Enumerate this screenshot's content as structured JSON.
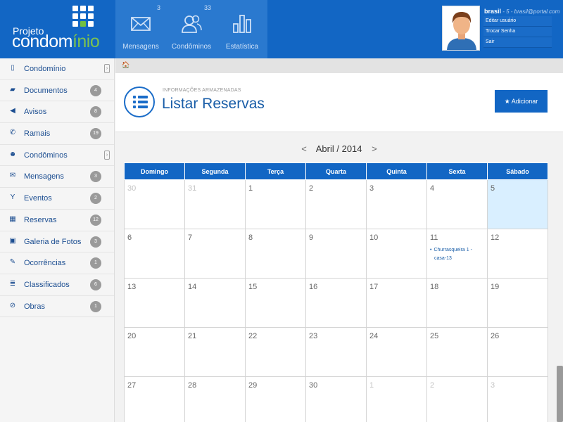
{
  "header": {
    "logo_line1": "Projeto",
    "logo_line2_a": "condom",
    "logo_line2_b": "ínio",
    "nav": [
      {
        "label": "Mensagens",
        "count": "3",
        "icon": "envelope-icon"
      },
      {
        "label": "Condôminos",
        "count": "33",
        "icon": "users-icon"
      },
      {
        "label": "Estatística",
        "count": "",
        "icon": "bar-chart-icon"
      }
    ],
    "user": {
      "name": "brasil",
      "detail": " - 5 - brasil@portal.com",
      "menu": [
        "Editar usuário",
        "Trocar Senha",
        "Sair"
      ]
    }
  },
  "sidebar": {
    "items": [
      {
        "label": "Condomínio",
        "icon": "building-icon",
        "badge": "",
        "caret": true
      },
      {
        "label": "Documentos",
        "icon": "folder-icon",
        "badge": "4",
        "caret": false
      },
      {
        "label": "Avisos",
        "icon": "megaphone-icon",
        "badge": "8",
        "caret": false
      },
      {
        "label": "Ramais",
        "icon": "phone-icon",
        "badge": "19",
        "caret": false
      },
      {
        "label": "Condôminos",
        "icon": "users-icon",
        "badge": "",
        "caret": true
      },
      {
        "label": "Mensagens",
        "icon": "envelope-icon",
        "badge": "3",
        "caret": false
      },
      {
        "label": "Eventos",
        "icon": "glass-icon",
        "badge": "2",
        "caret": false
      },
      {
        "label": "Reservas",
        "icon": "calendar-icon",
        "badge": "12",
        "caret": false
      },
      {
        "label": "Galeria de Fotos",
        "icon": "picture-icon",
        "badge": "3",
        "caret": false
      },
      {
        "label": "Ocorrências",
        "icon": "edit-icon",
        "badge": "1",
        "caret": false
      },
      {
        "label": "Classificados",
        "icon": "list-icon",
        "badge": "6",
        "caret": false
      },
      {
        "label": "Obras",
        "icon": "ban-icon",
        "badge": "1",
        "caret": false
      }
    ]
  },
  "breadcrumb": {
    "home": "🏠"
  },
  "page": {
    "subtitle": "INFORMAÇÕES ARMAZENADAS",
    "title": "Listar Reservas",
    "add_label": "★ Adicionar"
  },
  "calendar": {
    "month_label": "Abril / 2014",
    "prev": "<",
    "next": ">",
    "weekdays": [
      "Domingo",
      "Segunda",
      "Terça",
      "Quarta",
      "Quinta",
      "Sexta",
      "Sábado"
    ],
    "weeks": [
      [
        {
          "d": "30",
          "m": true
        },
        {
          "d": "31",
          "m": true
        },
        {
          "d": "1"
        },
        {
          "d": "2"
        },
        {
          "d": "3"
        },
        {
          "d": "4"
        },
        {
          "d": "5",
          "today": true
        }
      ],
      [
        {
          "d": "6"
        },
        {
          "d": "7"
        },
        {
          "d": "8"
        },
        {
          "d": "9"
        },
        {
          "d": "10"
        },
        {
          "d": "11",
          "event": "Churrasqueira 1 - casa-13"
        },
        {
          "d": "12"
        }
      ],
      [
        {
          "d": "13"
        },
        {
          "d": "14"
        },
        {
          "d": "15"
        },
        {
          "d": "16"
        },
        {
          "d": "17"
        },
        {
          "d": "18"
        },
        {
          "d": "19"
        }
      ],
      [
        {
          "d": "20"
        },
        {
          "d": "21"
        },
        {
          "d": "22"
        },
        {
          "d": "23"
        },
        {
          "d": "24"
        },
        {
          "d": "25"
        },
        {
          "d": "26"
        }
      ],
      [
        {
          "d": "27"
        },
        {
          "d": "28"
        },
        {
          "d": "29"
        },
        {
          "d": "30"
        },
        {
          "d": "1",
          "m": true
        },
        {
          "d": "2",
          "m": true
        },
        {
          "d": "3",
          "m": true
        }
      ]
    ]
  }
}
